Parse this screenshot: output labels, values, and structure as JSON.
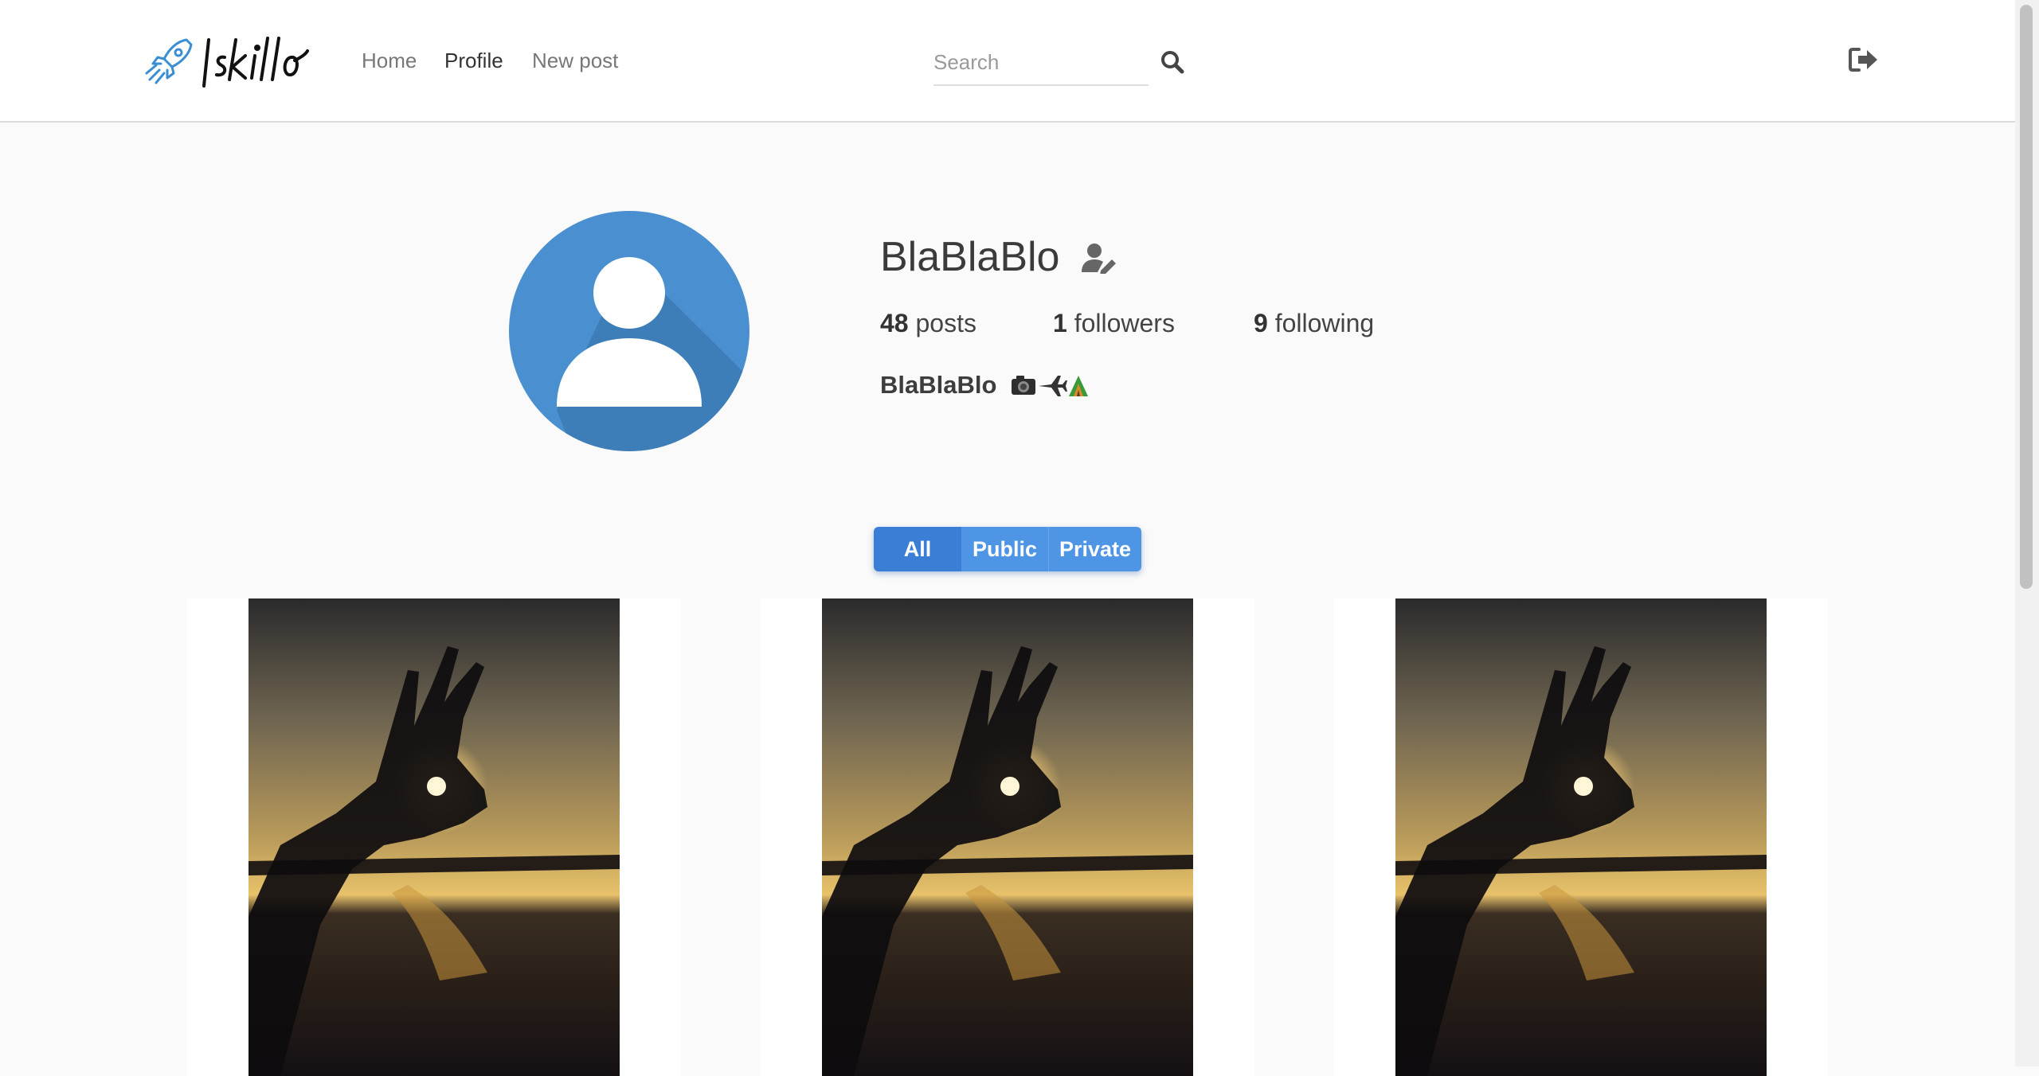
{
  "app": {
    "logo_text": "Iskillo"
  },
  "nav": {
    "home": "Home",
    "profile": "Profile",
    "new_post": "New post"
  },
  "search": {
    "placeholder": "Search",
    "value": ""
  },
  "icons": {
    "logo": "rocket-icon",
    "search": "search-icon",
    "logout": "sign-out-icon",
    "edit_profile": "user-edit-icon",
    "avatar": "default-user-avatar"
  },
  "profile": {
    "username": "BlaBlaBlo",
    "posts_count": "48",
    "posts_label": "posts",
    "followers_count": "1",
    "followers_label": "followers",
    "following_count": "9",
    "following_label": "following",
    "bio_name": "BlaBlaBlo",
    "bio_emojis": [
      "camera",
      "airplane",
      "camping"
    ]
  },
  "filter": {
    "all": "All",
    "public": "Public",
    "private": "Private",
    "selected": "All"
  },
  "posts": [
    {
      "image": "sunset hand silhouette on beach"
    },
    {
      "image": "sunset hand silhouette on beach"
    },
    {
      "image": "sunset hand silhouette on beach"
    }
  ],
  "colors": {
    "accent": "#3a7ed6",
    "accent_light": "#4f95e6",
    "avatar_bg": "#4a90d0",
    "logo_blue": "#3a8ed4",
    "page_bg": "#fafafa"
  }
}
